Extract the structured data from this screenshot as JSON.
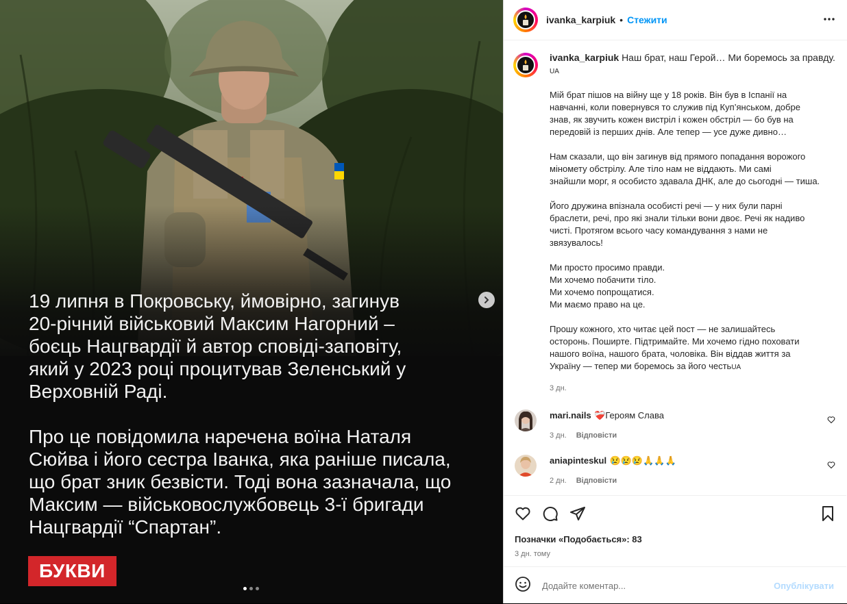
{
  "post": {
    "caption_lines_1": "19 липня в Покровську, ймовірно, загинув\n20-річний військовий Максим Нагорний –\nбоєць Нацгвардії й автор сповіді-заповіту,\nякий у 2023 році процитував Зеленський у\nВерховній Раді.",
    "caption_lines_2": "Про це повідомила наречена воїна Наталя\nСюйва і його сестра Іванка, яка раніше писала,\nщо брат зник безвісти. Тоді вона зазначала, що\nМаксим — військовослужбовець 3-ї бригади\nНацгвардії “Спартан”.",
    "brand_label": "БУКВИ",
    "carousel_dots": 3,
    "next_icon": "chevron-right-icon"
  },
  "header": {
    "username": "ivanka_karpiuk",
    "separator": "•",
    "follow_label": "Стежити",
    "more_icon": "more-horizontal-icon"
  },
  "caption": {
    "username": "ivanka_karpiuk",
    "first_line": "Наш брат, наш Герой… Ми боремось за правду.",
    "first_line_flag": "UA",
    "paragraphs": [
      "Мій брат пішов на війну ще у 18 років. Він був в Іспанії на\nнавчанні, коли повернувся то служив під Куп’янськом, добре\nзнав, як звучить кожен вистріл і кожен обстріл — бо був на\nпередовій із перших днів. Але тепер — усе дуже дивно…",
      "Нам сказали, що він загинув від прямого попадання ворожого\nміномету обстрілу. Але тіло нам не віддають. Ми самі\nзнайшли морг, я особисто здавала ДНК, але до сьогодні — тиша.",
      "Його дружина впізнала особисті речі — у них були парні\nбраслети, речі, про які знали тільки вони двоє. Речі як надиво\nчисті. Протягом всього часу командування з нами не\nзвязувалось!",
      "Ми просто просимо правди.\nМи хочемо побачити тіло.\nМи хочемо попрощатися.\nМи маємо право на це.",
      "Прошу кожного, хто читає цей пост — не залишайтесь\nосторонь. Поширте. Підтримайте. Ми хочемо гідно поховати\nнашого воїна, нашого брата, чоловіка. Він віддав життя за\nУкраїну — тепер ми боремось за його честь"
    ],
    "last_flag": "UA",
    "time": "3 дн."
  },
  "comments": [
    {
      "username": "mari.nails",
      "text": "❤️‍🩹Героям Слава",
      "time": "3 дн.",
      "reply_label": "Відповісти",
      "avatar_color": "#6b4a3a"
    },
    {
      "username": "aniapinteskul",
      "text": "😢😢😢🙏🙏🙏",
      "time": "2 дн.",
      "reply_label": "Відповісти",
      "avatar_color": "#c94a2e"
    }
  ],
  "actions": {
    "likes_label": "Позначки «Подобається»: 83",
    "ago": "3 дн. тому"
  },
  "composer": {
    "placeholder": "Додайте коментар...",
    "publish_label": "Опублікувати"
  }
}
